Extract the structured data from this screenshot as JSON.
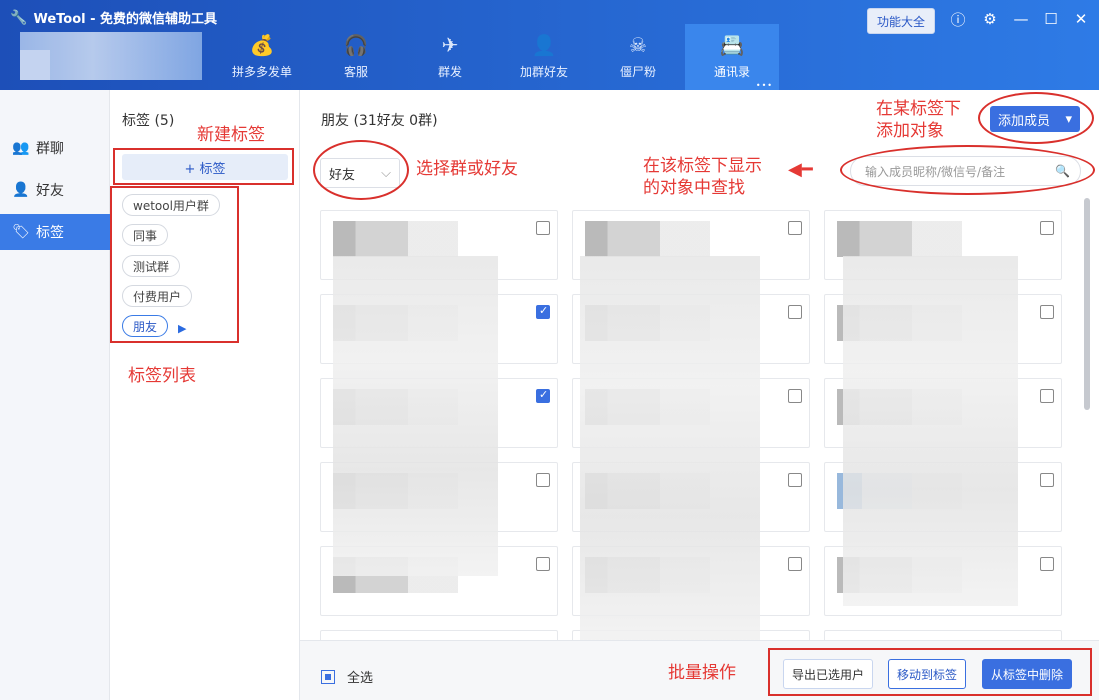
{
  "app": {
    "title": "WeTool - 免费的微信辅助工具"
  },
  "header": {
    "nav": [
      {
        "label": "拼多多发单",
        "icon": "money-bag-icon",
        "glyph": "💰"
      },
      {
        "label": "客服",
        "icon": "headset-icon",
        "glyph": "🎧"
      },
      {
        "label": "群发",
        "icon": "paper-plane-icon",
        "glyph": "✈"
      },
      {
        "label": "加群好友",
        "icon": "add-friend-icon",
        "glyph": "👤"
      },
      {
        "label": "僵尸粉",
        "icon": "skull-icon",
        "glyph": "☠"
      },
      {
        "label": "通讯录",
        "icon": "contacts-icon",
        "glyph": "📇"
      }
    ],
    "feature_button": "功能大全"
  },
  "left_nav": [
    {
      "label": "群聊",
      "icon": "group-chat-icon"
    },
    {
      "label": "好友",
      "icon": "friend-icon"
    },
    {
      "label": "标签",
      "icon": "tag-icon"
    }
  ],
  "tags": {
    "header": "标签 (5)",
    "add_button": "+ 标签",
    "items": [
      "wetool用户群",
      "同事",
      "测试群",
      "付费用户",
      "朋友"
    ]
  },
  "main": {
    "title": "朋友 (31好友 0群)",
    "add_member_button": "添加成员",
    "filter_value": "好友",
    "search_placeholder": "输入成员昵称/微信号/备注",
    "select_all_label": "全选",
    "export_button": "导出已选用户",
    "move_button": "移动到标签",
    "remove_button": "从标签中删除"
  },
  "annotations": {
    "new_tag": "新建标签",
    "tag_list": "标签列表",
    "select_group_friend": "选择群或好友",
    "search_hint_line1": "在该标签下显示",
    "search_hint_line2": "的对象中查找",
    "add_member_line1": "在某标签下",
    "add_member_line2": "添加对象",
    "batch": "批量操作"
  },
  "colors": {
    "accent": "#3a6fe0",
    "header": "#2e7be6",
    "annotation": "#e53935"
  }
}
